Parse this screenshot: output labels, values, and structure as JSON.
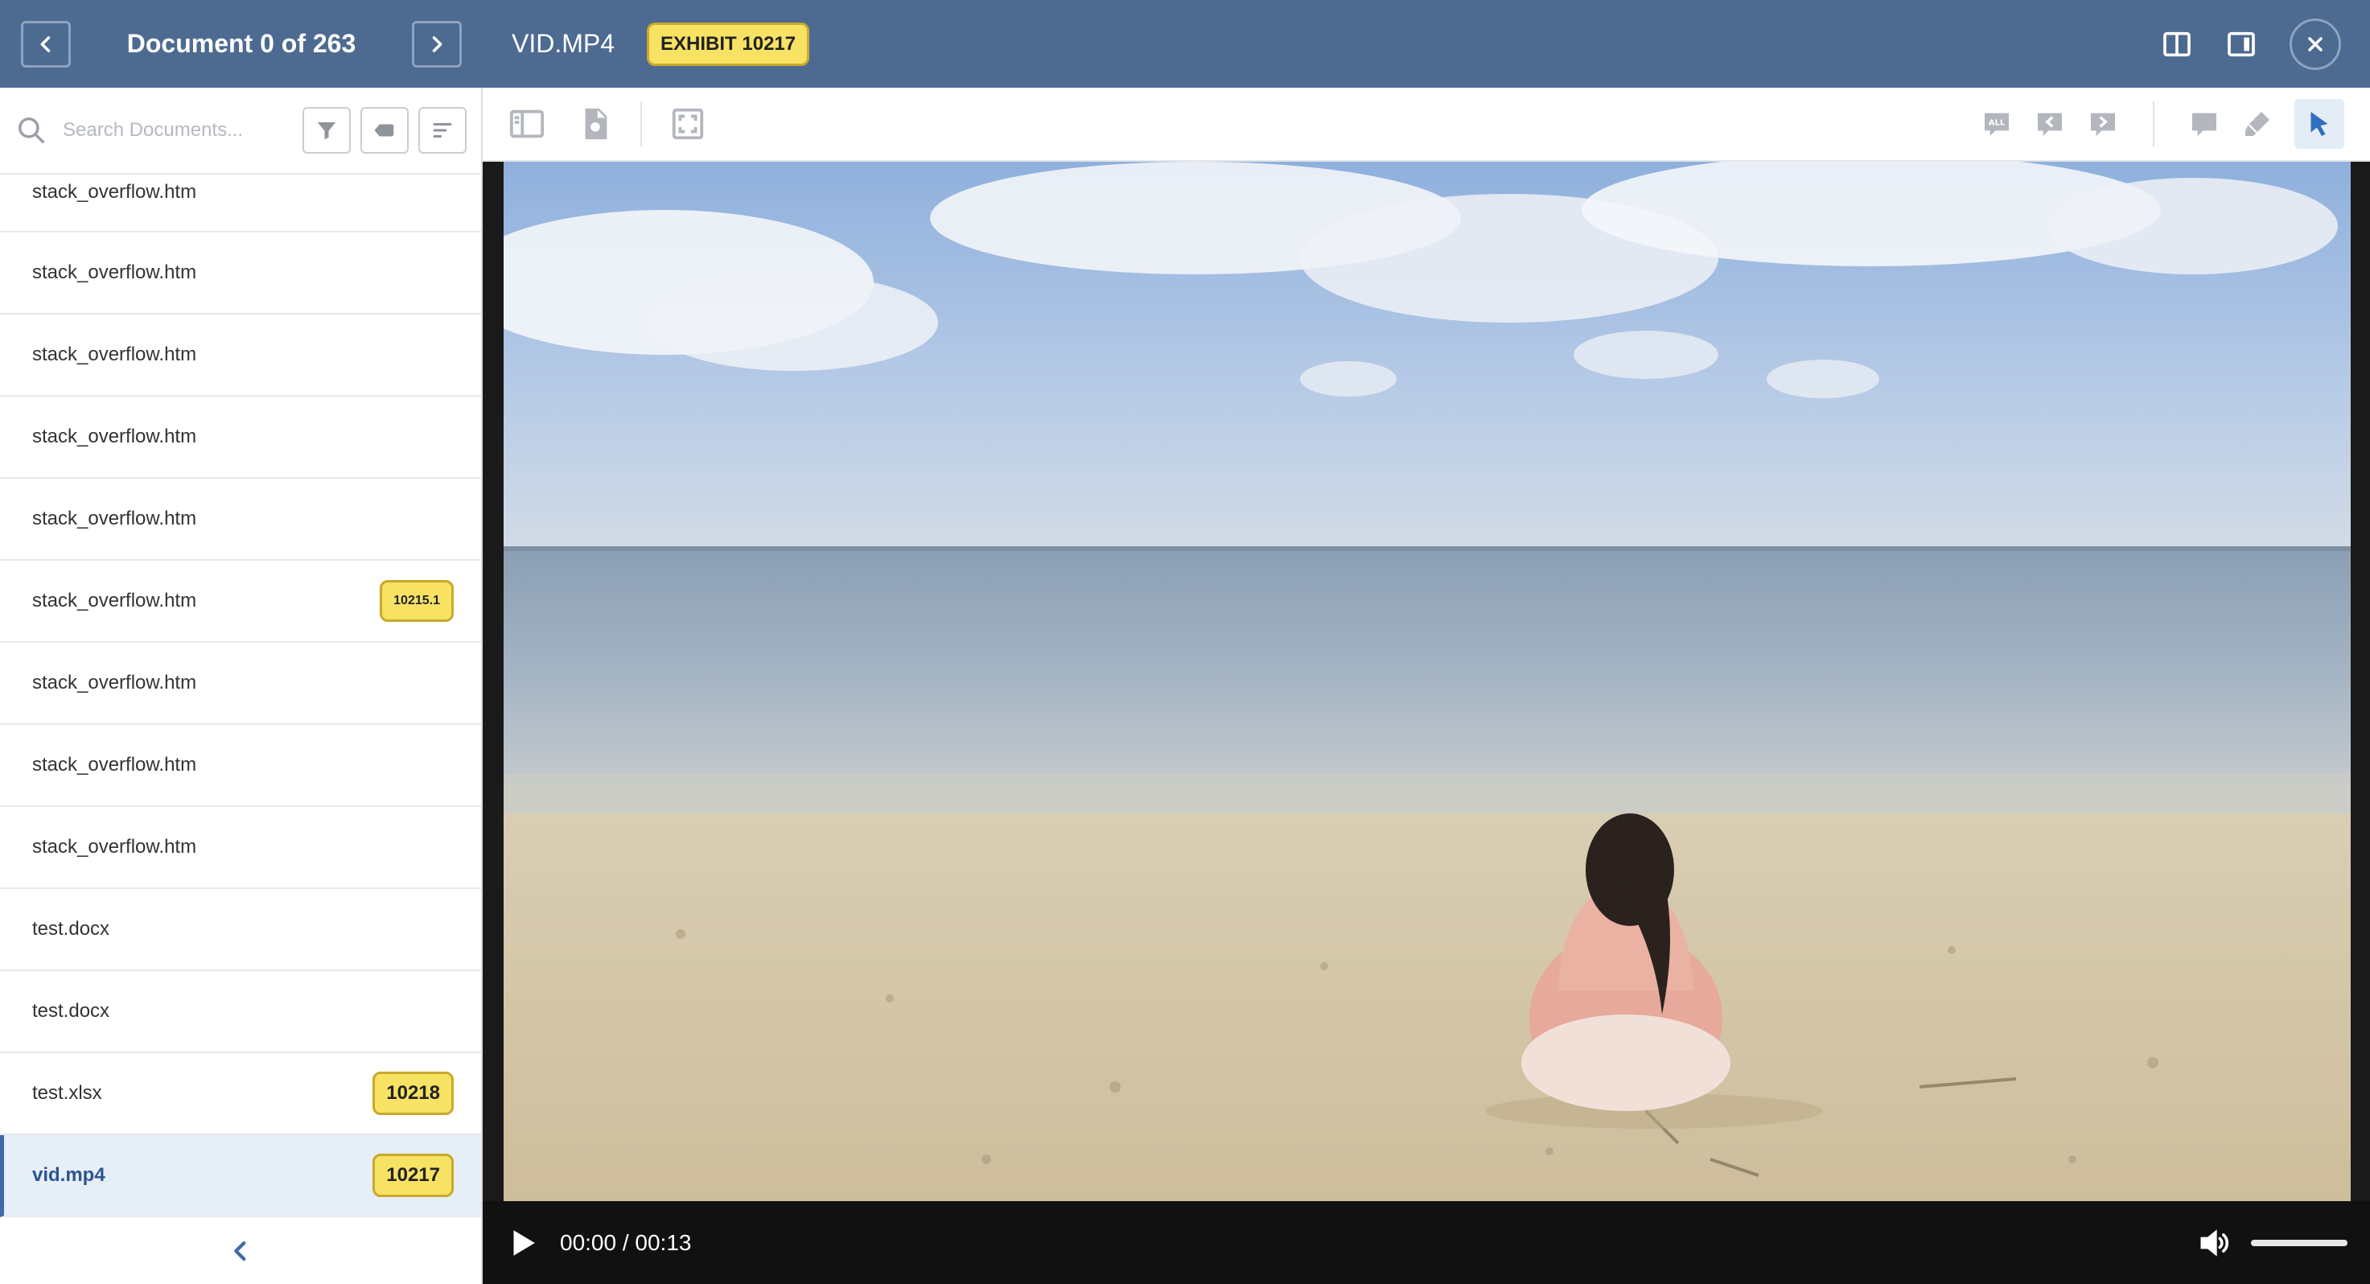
{
  "sidebar": {
    "title": "Document 0 of 263",
    "search_placeholder": "Search Documents...",
    "documents": [
      {
        "name": "stack_overflow.htm",
        "badge": ""
      },
      {
        "name": "stack_overflow.htm",
        "badge": ""
      },
      {
        "name": "stack_overflow.htm",
        "badge": ""
      },
      {
        "name": "stack_overflow.htm",
        "badge": ""
      },
      {
        "name": "stack_overflow.htm",
        "badge": ""
      },
      {
        "name": "stack_overflow.htm",
        "badge": "10215.1"
      },
      {
        "name": "stack_overflow.htm",
        "badge": ""
      },
      {
        "name": "stack_overflow.htm",
        "badge": ""
      },
      {
        "name": "stack_overflow.htm",
        "badge": ""
      },
      {
        "name": "test.docx",
        "badge": ""
      },
      {
        "name": "test.docx",
        "badge": ""
      },
      {
        "name": "test.xlsx",
        "badge": "10218"
      },
      {
        "name": "vid.mp4",
        "badge": "10217",
        "active": true
      }
    ]
  },
  "viewer": {
    "title": "VID.MP4",
    "exhibit": "EXHIBIT 10217"
  },
  "player": {
    "time": "00:00 / 00:13",
    "volume": 1.0
  },
  "icons": {
    "prev": "chevron-left-icon",
    "next": "chevron-right-icon",
    "search": "search-icon",
    "filter": "filter-icon",
    "tag": "tag-icon",
    "sort": "sort-icon",
    "collapse": "chevron-left-icon",
    "split_view": "split-view-icon",
    "side_panel": "side-panel-icon",
    "close": "close-icon",
    "thumbnails": "thumbnails-icon",
    "document_search": "document-search-icon",
    "fullscreen": "fullscreen-icon",
    "all_comments": "all-comments-icon",
    "prev_comment": "prev-comment-icon",
    "next_comment": "next-comment-icon",
    "comment": "comment-icon",
    "highlight": "highlighter-icon",
    "select": "cursor-icon",
    "play": "play-icon",
    "volume": "volume-icon"
  },
  "colors": {
    "header_bg": "#4d6a91",
    "badge_bg": "#f7e264",
    "active_row_bg": "#e6eef8",
    "accent": "#3f6aa6"
  }
}
